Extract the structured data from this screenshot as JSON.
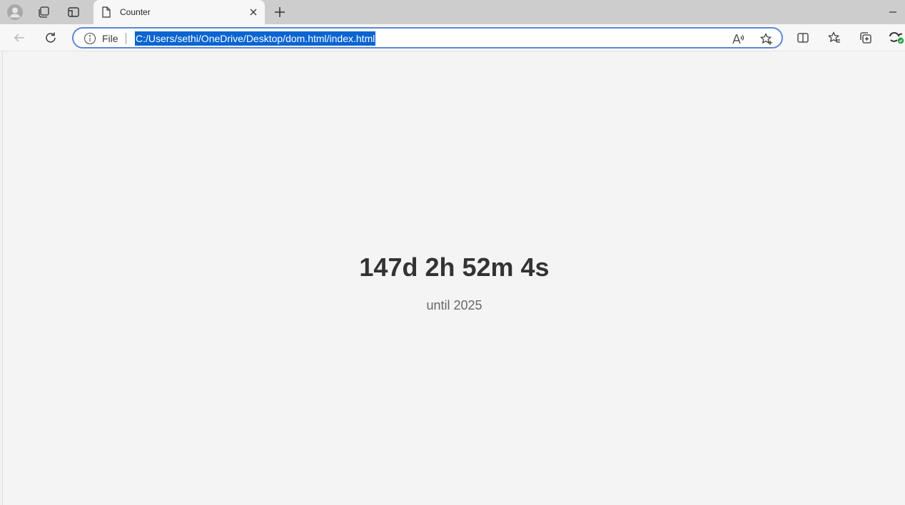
{
  "browser": {
    "tab": {
      "title": "Counter"
    },
    "address_bar": {
      "scheme_label": "File",
      "url": "C:/Users/sethi/OneDrive/Desktop/dom.html/index.html"
    }
  },
  "page": {
    "countdown": "147d 2h 52m 4s",
    "subtitle": "until 2025"
  },
  "colors": {
    "url_selection": "#0a64d1",
    "address_focus_border": "#5b87d6",
    "page_background": "#f4f4f4",
    "heading_text": "#333333",
    "subtitle_text": "#666666",
    "extension_badge": "#1e9e3a"
  },
  "icons": [
    "profile-icon",
    "workspaces-icon",
    "vertical-tabs-icon",
    "document-icon",
    "close-icon",
    "new-tab-icon",
    "minimize-icon",
    "back-icon",
    "refresh-icon",
    "info-icon",
    "read-aloud-icon",
    "add-favorite-icon",
    "split-screen-icon",
    "favorites-icon",
    "collections-icon",
    "extension-icon"
  ]
}
